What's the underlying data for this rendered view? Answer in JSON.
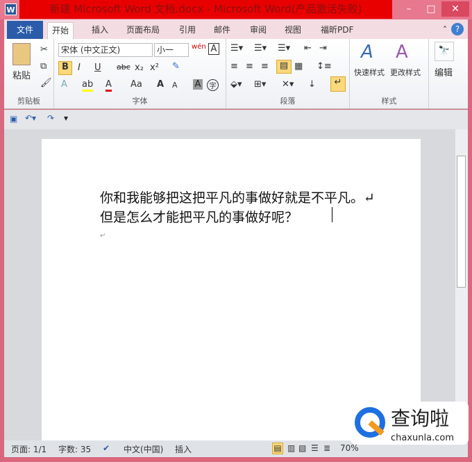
{
  "window": {
    "title": "新建 Microsoft Word 文档.docx - Microsoft Word(产品激活失败)",
    "app_icon": "W",
    "controls": [
      "minimize",
      "maximize",
      "close"
    ]
  },
  "tabs": {
    "file": "文件",
    "items": [
      "开始",
      "插入",
      "页面布局",
      "引用",
      "邮件",
      "审阅",
      "视图",
      "福昕PDF"
    ],
    "active": "开始"
  },
  "ribbon": {
    "clipboard": {
      "label": "剪贴板",
      "paste": "粘贴"
    },
    "font": {
      "label": "字体",
      "font_name": "宋体 (中文正文)",
      "font_size": "小一",
      "bold": "B",
      "italic": "I",
      "underline": "U",
      "strike": "abc",
      "sub": "x₂",
      "sup": "x²",
      "grow": "A",
      "shrink": "A",
      "case": "Aa",
      "clear": "A",
      "char_border": "A",
      "phonetic": "wén",
      "enclose": "字"
    },
    "paragraph": {
      "label": "段落"
    },
    "styles": {
      "label": "样式",
      "quick": "快速样式",
      "change": "更改样式"
    },
    "editing": {
      "label": "编辑"
    }
  },
  "document": {
    "lines": [
      "你和我能够把这把平凡的事做好就是不平凡。↵",
      "但是怎么才能把平凡的事做好呢？"
    ]
  },
  "status": {
    "page": "页面: 1/1",
    "words": "字数: 35",
    "language": "中文(中国)",
    "mode": "插入",
    "zoom": "70%"
  },
  "watermark": {
    "brand": "查询啦",
    "url": "chaxunla.com"
  },
  "colors": {
    "title_bar": "#e80000",
    "file_tab": "#2a5caa",
    "frame": "#d9687f"
  }
}
